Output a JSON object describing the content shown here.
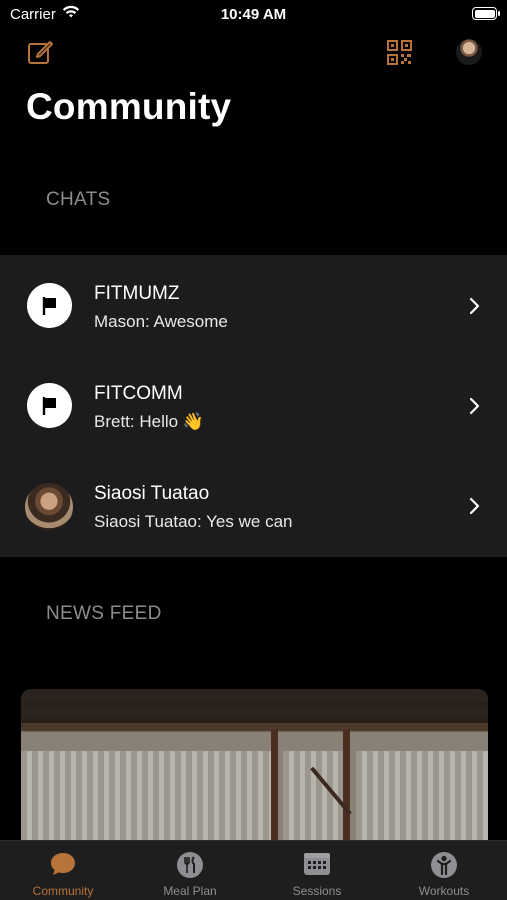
{
  "status_bar": {
    "carrier": "Carrier",
    "time": "10:49 AM"
  },
  "header": {
    "title": "Community"
  },
  "sections": {
    "chats": "CHATS",
    "news_feed": "NEWS FEED"
  },
  "chats": [
    {
      "name": "FITMUMZ",
      "message": "Mason: Awesome",
      "avatar": "flag-icon"
    },
    {
      "name": "FITCOMM",
      "message": "Brett: Hello 👋",
      "avatar": "flag-icon"
    },
    {
      "name": "Siaosi Tuatao",
      "message": "Siaosi Tuatao: Yes we can",
      "avatar": "user-photo"
    }
  ],
  "tabs": [
    {
      "label": "Community",
      "icon": "chat-bubble-icon",
      "active": true
    },
    {
      "label": "Meal Plan",
      "icon": "fork-knife-icon",
      "active": false
    },
    {
      "label": "Sessions",
      "icon": "calendar-icon",
      "active": false
    },
    {
      "label": "Workouts",
      "icon": "person-icon",
      "active": false
    }
  ],
  "colors": {
    "accent": "#b8733a",
    "background": "#000000",
    "list_background": "#1c1c1e",
    "inactive": "#8e8e93"
  }
}
